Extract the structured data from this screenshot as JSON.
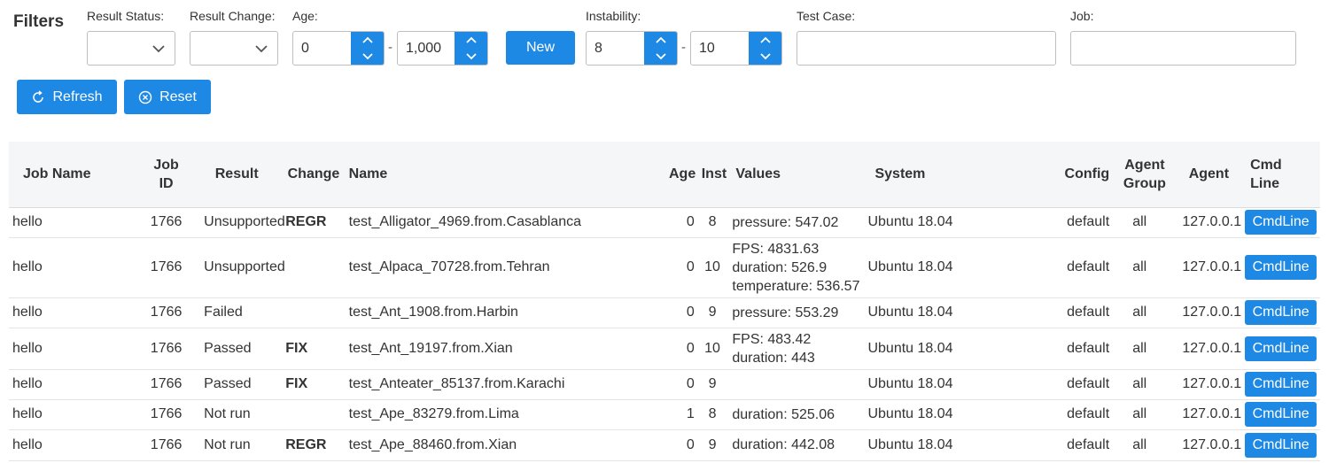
{
  "filters": {
    "title": "Filters",
    "result_status_label": "Result Status:",
    "result_change_label": "Result Change:",
    "age_label": "Age:",
    "age_min": "0",
    "age_max": "1,000",
    "new_button": "New",
    "instability_label": "Instability:",
    "instability_min": "8",
    "instability_max": "10",
    "test_case_label": "Test Case:",
    "job_label": "Job:",
    "dash": "-",
    "refresh_button": "Refresh",
    "reset_button": "Reset"
  },
  "table": {
    "headers": {
      "job_name": "Job Name",
      "job_id_1": "Job",
      "job_id_2": "ID",
      "result": "Result",
      "change": "Change",
      "name": "Name",
      "age": "Age",
      "instability": "Inst",
      "values": "Values",
      "system": "System",
      "config": "Config",
      "agent_group_1": "Agent",
      "agent_group_2": "Group",
      "agent": "Agent",
      "cmd_line_1": "Cmd",
      "cmd_line_2": "Line"
    },
    "rows": [
      {
        "job_name": "hello",
        "job_id": "1766",
        "result": "Unsupported",
        "result_class": "",
        "change": "REGR",
        "change_class": "chg-regr",
        "name": "test_Alligator_4969.from.Casablanca",
        "age": "0",
        "instability": "8",
        "values": [
          "pressure: 547.02"
        ],
        "system": "Ubuntu 18.04",
        "config": "default",
        "agent_group": "all",
        "agent": "127.0.0.1",
        "cmd": "CmdLine"
      },
      {
        "job_name": "hello",
        "job_id": "1766",
        "result": "Unsupported",
        "result_class": "",
        "change": "",
        "change_class": "",
        "name": "test_Alpaca_70728.from.Tehran",
        "age": "0",
        "instability": "10",
        "values": [
          "FPS: 4831.63",
          "duration: 526.9",
          "temperature: 536.57"
        ],
        "system": "Ubuntu 18.04",
        "config": "default",
        "agent_group": "all",
        "agent": "127.0.0.1",
        "cmd": "CmdLine"
      },
      {
        "job_name": "hello",
        "job_id": "1766",
        "result": "Failed",
        "result_class": "res-fail",
        "change": "",
        "change_class": "",
        "name": "test_Ant_1908.from.Harbin",
        "age": "0",
        "instability": "9",
        "values": [
          "pressure: 553.29"
        ],
        "system": "Ubuntu 18.04",
        "config": "default",
        "agent_group": "all",
        "agent": "127.0.0.1",
        "cmd": "CmdLine"
      },
      {
        "job_name": "hello",
        "job_id": "1766",
        "result": "Passed",
        "result_class": "res-pass",
        "change": "FIX",
        "change_class": "chg-fix",
        "name": "test_Ant_19197.from.Xian",
        "age": "0",
        "instability": "10",
        "values": [
          "FPS: 483.42",
          "duration: 443"
        ],
        "system": "Ubuntu 18.04",
        "config": "default",
        "agent_group": "all",
        "agent": "127.0.0.1",
        "cmd": "CmdLine"
      },
      {
        "job_name": "hello",
        "job_id": "1766",
        "result": "Passed",
        "result_class": "res-pass",
        "change": "FIX",
        "change_class": "chg-fix",
        "name": "test_Anteater_85137.from.Karachi",
        "age": "0",
        "instability": "9",
        "values": [],
        "system": "Ubuntu 18.04",
        "config": "default",
        "agent_group": "all",
        "agent": "127.0.0.1",
        "cmd": "CmdLine"
      },
      {
        "job_name": "hello",
        "job_id": "1766",
        "result": "Not run",
        "result_class": "res-notrun",
        "change": "",
        "change_class": "",
        "name": "test_Ape_83279.from.Lima",
        "age": "1",
        "instability": "8",
        "values": [
          "duration: 525.06"
        ],
        "system": "Ubuntu 18.04",
        "config": "default",
        "agent_group": "all",
        "agent": "127.0.0.1",
        "cmd": "CmdLine"
      },
      {
        "job_name": "hello",
        "job_id": "1766",
        "result": "Not run",
        "result_class": "res-notrun",
        "change": "REGR",
        "change_class": "chg-regr",
        "name": "test_Ape_88460.from.Xian",
        "age": "0",
        "instability": "9",
        "values": [
          "duration: 442.08"
        ],
        "system": "Ubuntu 18.04",
        "config": "default",
        "agent_group": "all",
        "agent": "127.0.0.1",
        "cmd": "CmdLine"
      }
    ]
  },
  "colors": {
    "accent": "#1e88e5",
    "link": "#1a6fbb",
    "failed": "#e53935",
    "passed": "#2e8b17",
    "not_run": "#fb8c00",
    "regr": "#8b0000",
    "fix": "#1f8a1f",
    "header_bg": "#f5f6f8"
  }
}
